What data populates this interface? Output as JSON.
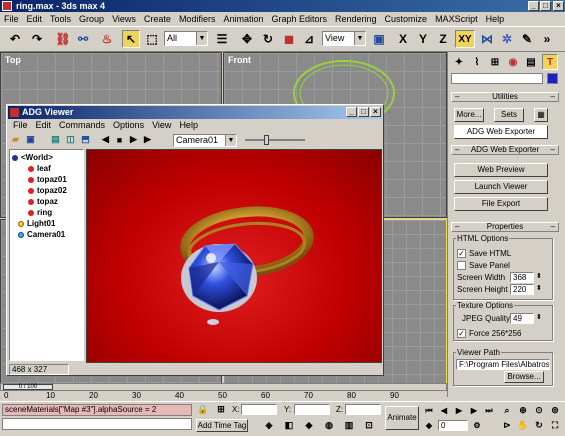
{
  "app": {
    "title": "ring.max - 3ds max 4"
  },
  "menu": [
    "File",
    "Edit",
    "Tools",
    "Group",
    "Views",
    "Create",
    "Modifiers",
    "Animation",
    "Graph Editors",
    "Rendering",
    "Customize",
    "MAXScript",
    "Help"
  ],
  "toolbar": {
    "selection_filter": "All",
    "ref_coord": "View",
    "axis_x": "X",
    "axis_y": "Y",
    "axis_z": "Z",
    "axis_xy": "XY"
  },
  "viewports": {
    "top": "Top",
    "front": "Front"
  },
  "adg": {
    "title": "ADG Viewer",
    "menu": [
      "File",
      "Edit",
      "Commands",
      "Options",
      "View",
      "Help"
    ],
    "camera": "Camera01",
    "tree": [
      "<World>",
      "leaf",
      "topaz01",
      "topaz02",
      "topaz",
      "ring",
      "Light01",
      "Camera01"
    ],
    "status": "468 x 327"
  },
  "panel": {
    "utilities_header": "Utilities",
    "more": "More...",
    "sets": "Sets",
    "adg_web_exporter_btn": "ADG Web Exporter",
    "adg_header": "ADG Web Exporter",
    "web_preview": "Web Preview",
    "launch_viewer": "Launch Viewer",
    "file_export": "File Export",
    "properties_header": "Properties",
    "html_options": "HTML Options",
    "save_html": "Save HTML",
    "save_panel": "Save Panel",
    "screen_width_label": "Screen Width",
    "screen_width": "368",
    "screen_height_label": "Screen Height",
    "screen_height": "220",
    "texture_options": "Texture Options",
    "jpeg_label": "JPEG Quality",
    "jpeg_value": "49",
    "force": "Force 256*256",
    "viewer_path_label": "Viewer Path",
    "viewer_path": "F:\\Program Files\\Albatross\\AL",
    "browse": "Browse..."
  },
  "timeline": {
    "ticks": [
      "0",
      "10",
      "20",
      "30",
      "40",
      "50",
      "60",
      "70",
      "80",
      "90"
    ],
    "frame_display": "0 / 100"
  },
  "bottom": {
    "maxscript": "sceneMaterials[\"Map #3\"].alphaSource = 2",
    "add_time_tag": "Add Time Tag",
    "x_label": "X:",
    "y_label": "Y:",
    "z_label": "Z:",
    "animate": "Animate",
    "frame": "0"
  }
}
